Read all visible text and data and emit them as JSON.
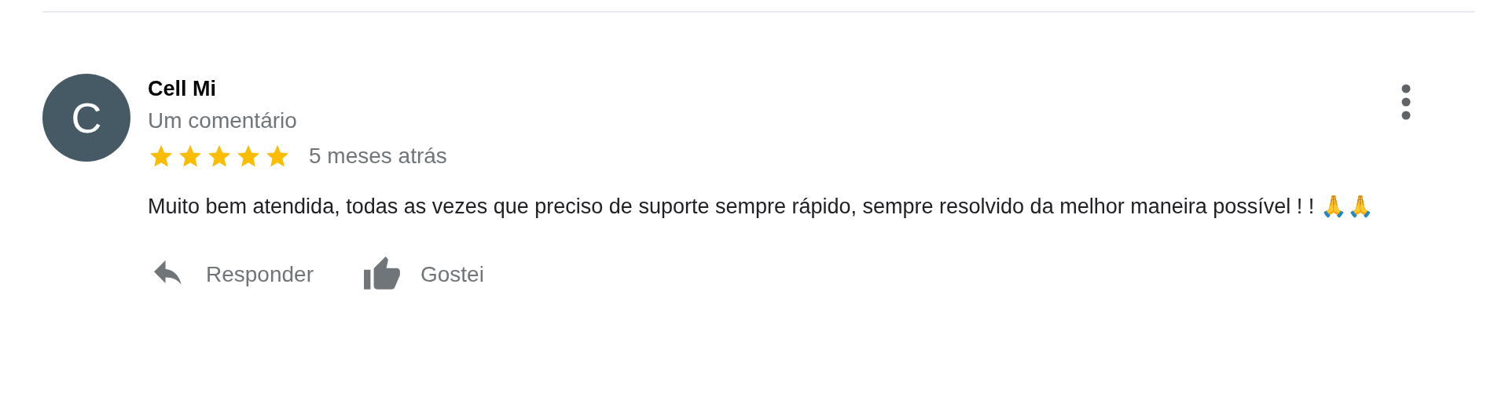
{
  "review": {
    "avatar_letter": "C",
    "author": "Cell Mi",
    "subtitle": "Um comentário",
    "stars": 5,
    "time": "5 meses atrás",
    "text": "Muito bem atendida, todas as vezes que preciso de suporte sempre rápido, sempre resolvido da melhor maneira possível !  ! 🙏🙏",
    "actions": [
      {
        "kind": "reply",
        "label": "Responder"
      },
      {
        "kind": "like",
        "label": "Gostei"
      }
    ]
  }
}
